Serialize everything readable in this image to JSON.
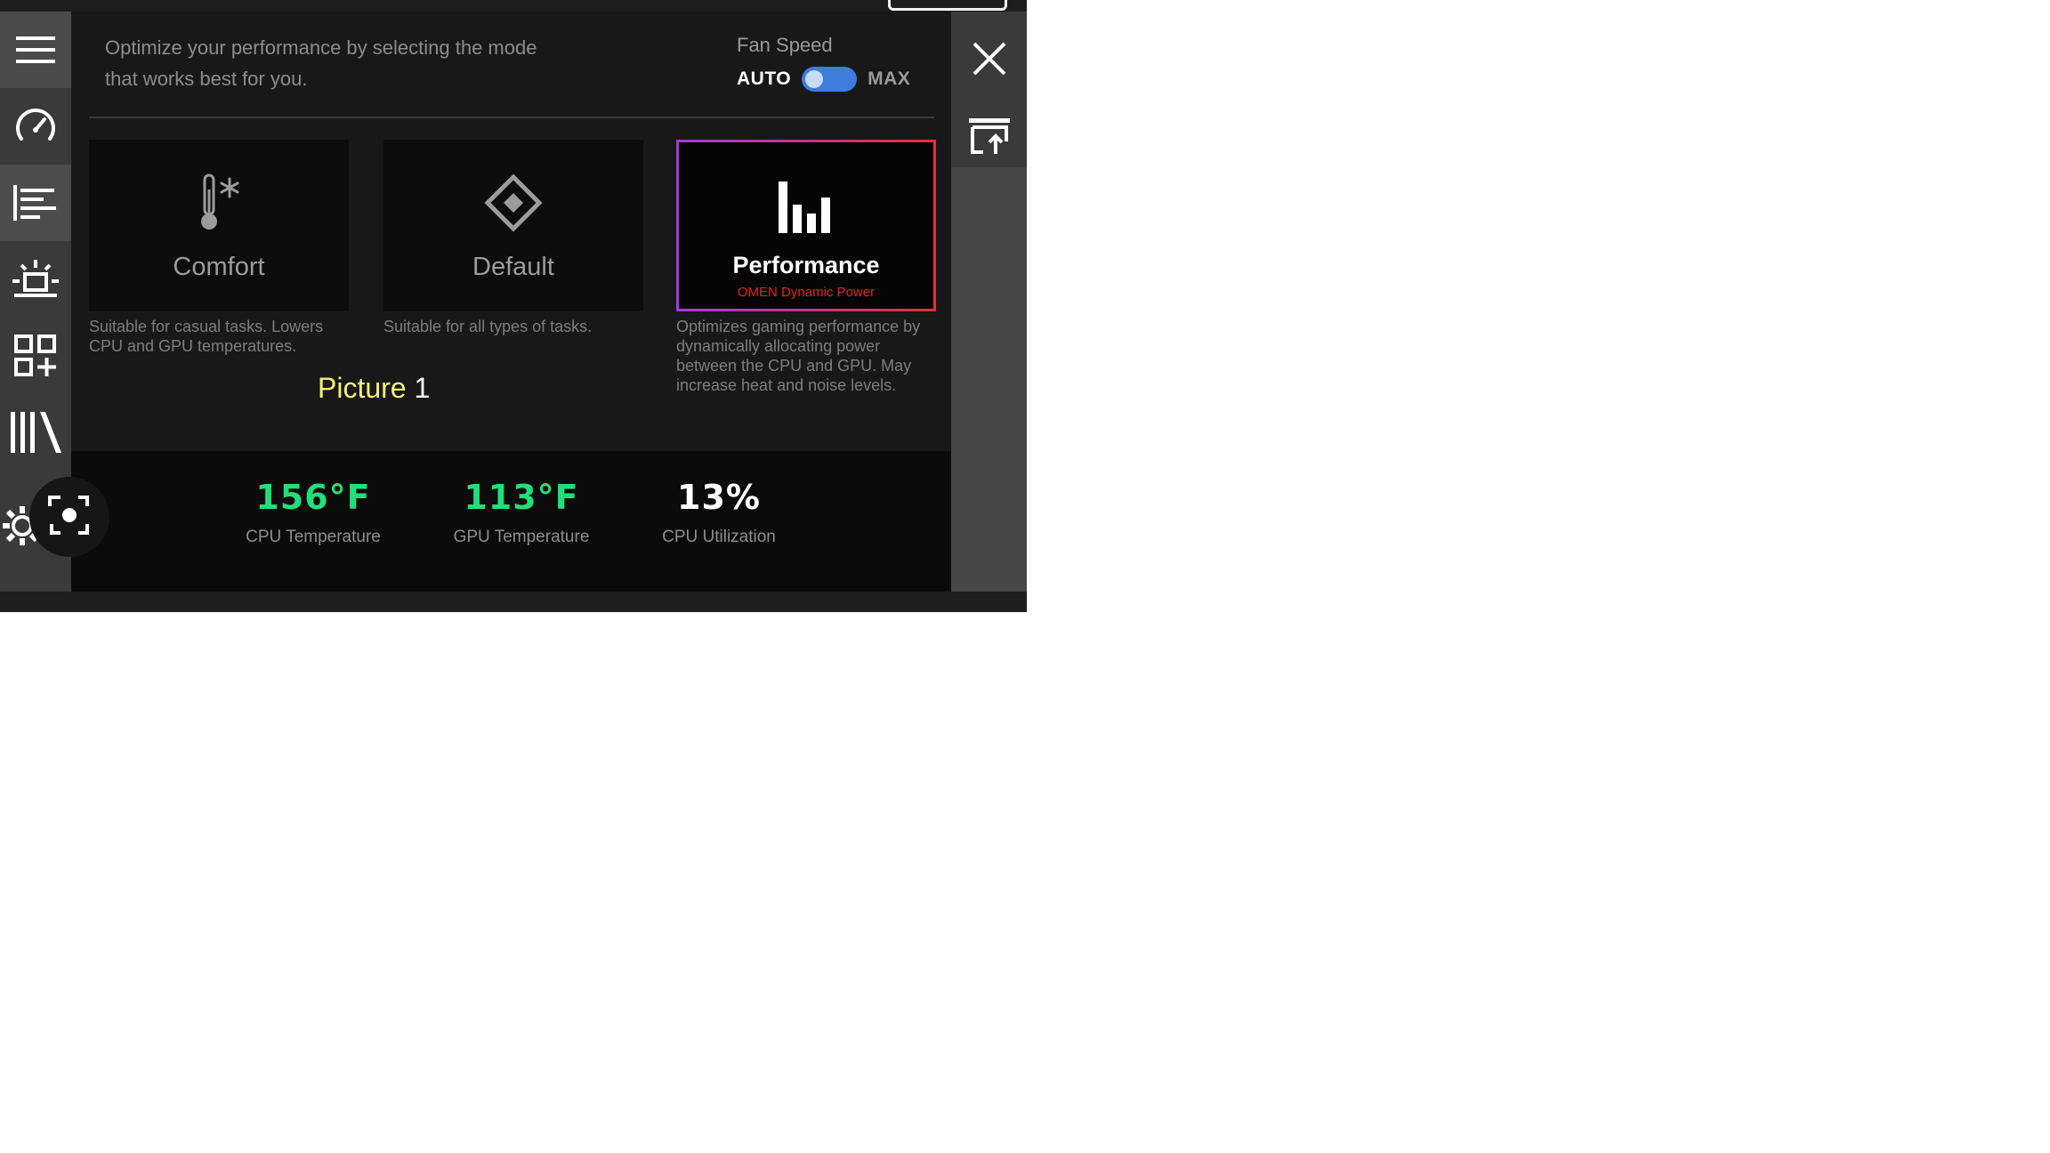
{
  "intro_text": "Optimize your performance by selecting the mode that works best for you.",
  "fan_speed": {
    "title": "Fan Speed",
    "auto_label": "AUTO",
    "max_label": "MAX",
    "mode_selected": "AUTO",
    "toggle_color": "#3e7ddb"
  },
  "modes": [
    {
      "label": "Comfort",
      "icon": "thermometer-snowflake-icon",
      "description": "Suitable for casual tasks. Lowers CPU and GPU temperatures.",
      "selected": false
    },
    {
      "label": "Default",
      "icon": "diamond-icon",
      "description": "Suitable for all types of tasks.",
      "selected": false
    },
    {
      "label": "Performance",
      "sublabel": "OMEN Dynamic Power",
      "icon": "bar-chart-icon",
      "description": "Optimizes gaming performance by dynamically allocating power between the CPU and GPU. May increase heat and noise levels.",
      "selected": true
    }
  ],
  "picture_label": {
    "word": "Picture",
    "number": "1"
  },
  "stats": [
    {
      "value": "156°F",
      "label": "CPU Temperature",
      "color": "#1fe07a"
    },
    {
      "value": "113°F",
      "label": "GPU Temperature",
      "color": "#1fe07a"
    },
    {
      "value": "13%",
      "label": "CPU Utilization",
      "color": "#ffffff"
    }
  ],
  "left_nav": [
    {
      "icon": "hamburger-menu-icon"
    },
    {
      "icon": "speedometer-icon"
    },
    {
      "icon": "performance-list-icon",
      "active": true
    },
    {
      "icon": "lighting-icon"
    },
    {
      "icon": "add-widget-icon"
    },
    {
      "icon": "library-icon"
    },
    {
      "icon": "settings-gear-icon"
    }
  ],
  "right_rail": [
    {
      "icon": "close-icon"
    },
    {
      "icon": "pop-out-icon"
    }
  ],
  "colors": {
    "accent_red": "#e2261c",
    "selected_border_start": "#a33bd8",
    "selected_border_end": "#e0333a",
    "picture_label": "#f4f176"
  }
}
